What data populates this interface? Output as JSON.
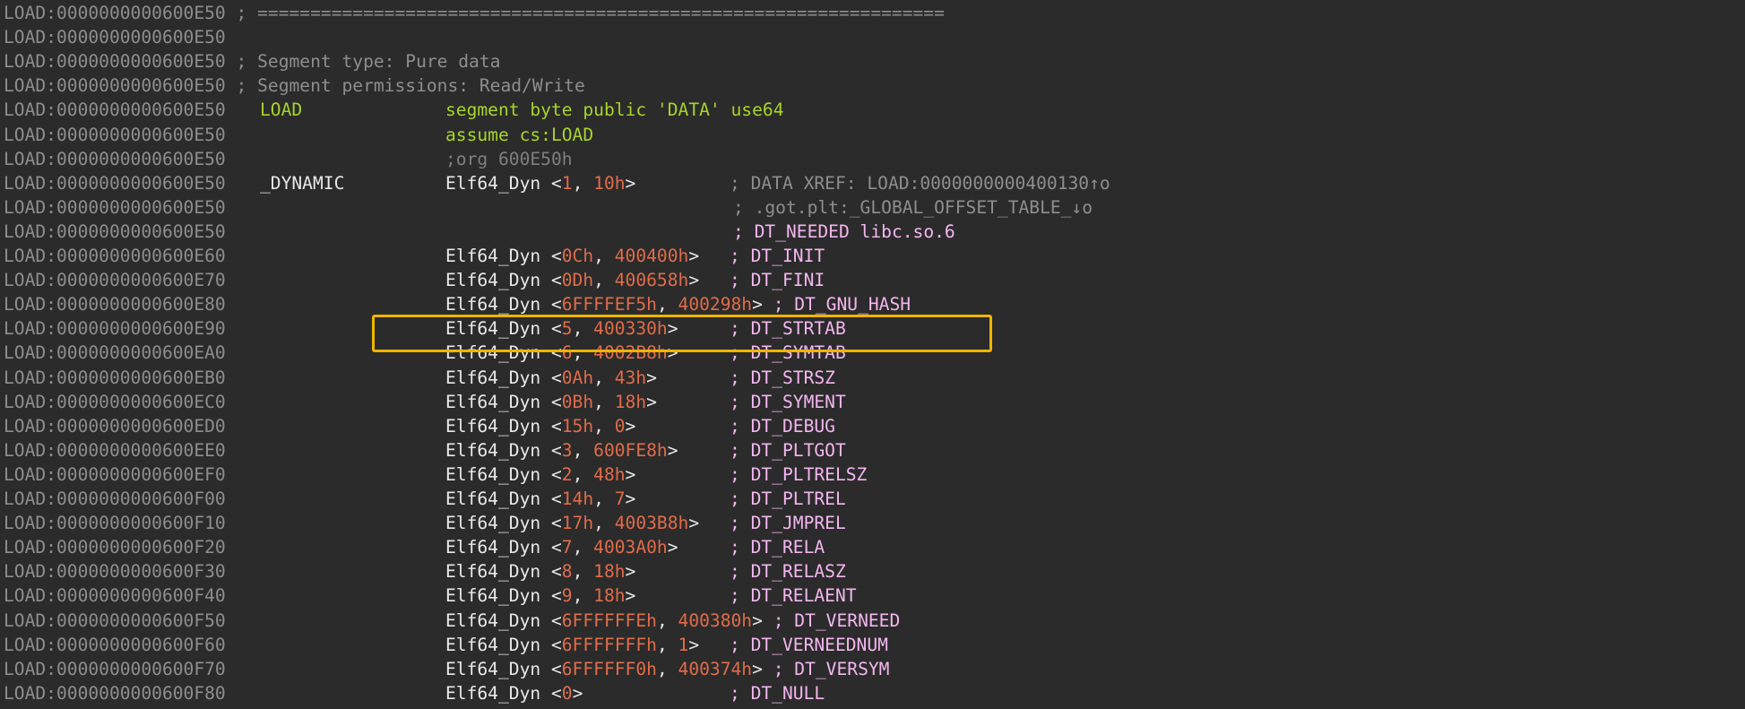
{
  "lines": [
    {
      "addr": "LOAD:0000000000600E50",
      "comment": "; ================================================================="
    },
    {
      "addr": "LOAD:0000000000600E50"
    },
    {
      "addr": "LOAD:0000000000600E50",
      "comment": "; Segment type: Pure data"
    },
    {
      "addr": "LOAD:0000000000600E50",
      "comment": "; Segment permissions: Read/Write"
    },
    {
      "addr": "LOAD:0000000000600E50",
      "label": "LOAD",
      "directive": "segment byte public 'DATA' use64"
    },
    {
      "addr": "LOAD:0000000000600E50",
      "directive": "assume cs:LOAD"
    },
    {
      "addr": "LOAD:0000000000600E50",
      "dim_directive": ";org 600E50h"
    },
    {
      "addr": "LOAD:0000000000600E50",
      "label": "_DYNAMIC",
      "type": "Elf64_Dyn",
      "a": "1",
      "b": "10h",
      "xref": "; DATA XREF: LOAD:0000000000400130↑o"
    },
    {
      "addr": "LOAD:0000000000600E50",
      "xref": "; .got.plt:_GLOBAL_OFFSET_TABLE_↓o"
    },
    {
      "addr": "LOAD:0000000000600E50",
      "tag": "; DT_NEEDED libc.so.6"
    },
    {
      "addr": "LOAD:0000000000600E60",
      "type": "Elf64_Dyn",
      "a": "0Ch",
      "b": "400400h",
      "tag": "; DT_INIT"
    },
    {
      "addr": "LOAD:0000000000600E70",
      "type": "Elf64_Dyn",
      "a": "0Dh",
      "b": "400658h",
      "tag": "; DT_FINI"
    },
    {
      "addr": "LOAD:0000000000600E80",
      "type": "Elf64_Dyn",
      "a": "6FFFFEF5h",
      "b": "400298h",
      "tag": "; DT_GNU_HASH"
    },
    {
      "addr": "LOAD:0000000000600E90",
      "type": "Elf64_Dyn",
      "a": "5",
      "b": "400330h",
      "tag": "; DT_STRTAB"
    },
    {
      "addr": "LOAD:0000000000600EA0",
      "type": "Elf64_Dyn",
      "a": "6",
      "b": "4002B8h",
      "tag": "; DT_SYMTAB"
    },
    {
      "addr": "LOAD:0000000000600EB0",
      "type": "Elf64_Dyn",
      "a": "0Ah",
      "b": "43h",
      "tag": "; DT_STRSZ"
    },
    {
      "addr": "LOAD:0000000000600EC0",
      "type": "Elf64_Dyn",
      "a": "0Bh",
      "b": "18h",
      "tag": "; DT_SYMENT"
    },
    {
      "addr": "LOAD:0000000000600ED0",
      "type": "Elf64_Dyn",
      "a": "15h",
      "b": "0",
      "tag": "; DT_DEBUG"
    },
    {
      "addr": "LOAD:0000000000600EE0",
      "type": "Elf64_Dyn",
      "a": "3",
      "b": "600FE8h",
      "tag": "; DT_PLTGOT"
    },
    {
      "addr": "LOAD:0000000000600EF0",
      "type": "Elf64_Dyn",
      "a": "2",
      "b": "48h",
      "tag": "; DT_PLTRELSZ"
    },
    {
      "addr": "LOAD:0000000000600F00",
      "type": "Elf64_Dyn",
      "a": "14h",
      "b": "7",
      "tag": "; DT_PLTREL"
    },
    {
      "addr": "LOAD:0000000000600F10",
      "type": "Elf64_Dyn",
      "a": "17h",
      "b": "4003B8h",
      "tag": "; DT_JMPREL"
    },
    {
      "addr": "LOAD:0000000000600F20",
      "type": "Elf64_Dyn",
      "a": "7",
      "b": "4003A0h",
      "tag": "; DT_RELA"
    },
    {
      "addr": "LOAD:0000000000600F30",
      "type": "Elf64_Dyn",
      "a": "8",
      "b": "18h",
      "tag": "; DT_RELASZ"
    },
    {
      "addr": "LOAD:0000000000600F40",
      "type": "Elf64_Dyn",
      "a": "9",
      "b": "18h",
      "tag": "; DT_RELAENT"
    },
    {
      "addr": "LOAD:0000000000600F50",
      "type": "Elf64_Dyn",
      "a": "6FFFFFFEh",
      "b": "400380h",
      "tag": "; DT_VERNEED"
    },
    {
      "addr": "LOAD:0000000000600F60",
      "type": "Elf64_Dyn",
      "a": "6FFFFFFFh",
      "b": "1",
      "tag": "; DT_VERNEEDNUM"
    },
    {
      "addr": "LOAD:0000000000600F70",
      "type": "Elf64_Dyn",
      "a": "6FFFFFF0h",
      "b": "400374h",
      "tag": "; DT_VERSYM"
    },
    {
      "addr": "LOAD:0000000000600F80",
      "type": "Elf64_Dyn",
      "a": "0",
      "tag": "; DT_NULL"
    }
  ],
  "highlight": {
    "color": "#f0b400",
    "target_line": 13
  }
}
